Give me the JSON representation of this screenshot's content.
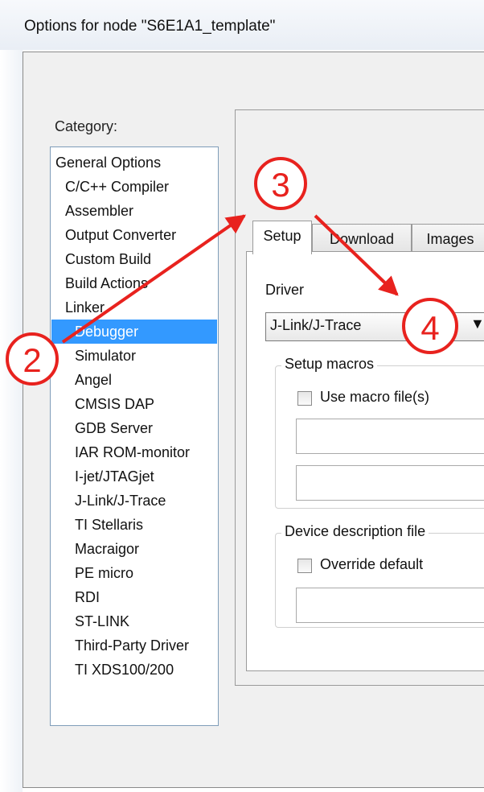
{
  "window": {
    "title": "Options for node \"S6E1A1_template\""
  },
  "category": {
    "label": "Category:",
    "items": [
      "General Options",
      "C/C++ Compiler",
      "Assembler",
      "Output Converter",
      "Custom Build",
      "Build Actions",
      "Linker",
      "Debugger",
      "Simulator",
      "Angel",
      "CMSIS DAP",
      "GDB Server",
      "IAR ROM-monitor",
      "I-jet/JTAGjet",
      "J-Link/J-Trace",
      "TI Stellaris",
      "Macraigor",
      "PE micro",
      "RDI",
      "ST-LINK",
      "Third-Party Driver",
      "TI XDS100/200"
    ],
    "selected": "Debugger"
  },
  "tabs": [
    "Setup",
    "Download",
    "Images"
  ],
  "setup": {
    "driver_label": "Driver",
    "driver_value": "J-Link/J-Trace",
    "dropdown_icon": "triangle-down-icon",
    "setup_macros_legend": "Setup macros",
    "use_macro_label": "Use macro file(s)",
    "device_desc_legend": "Device description file",
    "override_label": "Override default"
  },
  "annotations": {
    "marker_2": "2",
    "marker_3": "3",
    "marker_4": "4",
    "color": "#e8221e"
  }
}
